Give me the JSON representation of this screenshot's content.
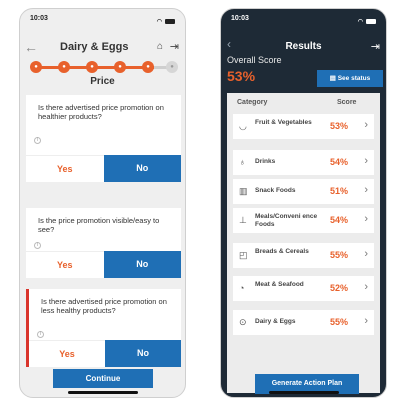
{
  "left": {
    "status_time": "10:03",
    "header": {
      "back_glyph": "←",
      "title": "Dairy & Eggs",
      "home_glyph": "⌂",
      "exit_glyph": "⇥"
    },
    "section_title": "Price",
    "questions": [
      {
        "text": "Is there advertised price promotion on healthier products?",
        "yes": "Yes",
        "no": "No",
        "selected": "No"
      },
      {
        "text": "Is the price promotion visible/easy to see?",
        "yes": "Yes",
        "no": "No",
        "selected": "No"
      },
      {
        "text": "Is there advertised price promotion on less healthy products?",
        "yes": "Yes",
        "no": "No",
        "selected": "No"
      }
    ],
    "info_glyph": "i",
    "continue_label": "Continue"
  },
  "right": {
    "status_time": "10:03",
    "title": "Results",
    "back_glyph": "‹",
    "exit_glyph": "⇥",
    "overall_label": "Overall Score",
    "overall_value": "53%",
    "see_status_label": "See status",
    "col_category": "Category",
    "col_score": "Score",
    "categories": [
      {
        "name": "Fruit & Vegetables",
        "score": "53%",
        "icon": "bowl-icon"
      },
      {
        "name": "Drinks",
        "score": "54%",
        "icon": "drink-icon"
      },
      {
        "name": "Snack Foods",
        "score": "51%",
        "icon": "snack-icon"
      },
      {
        "name": "Meals/Conveni ence Foods",
        "score": "54%",
        "icon": "meal-icon"
      },
      {
        "name": "Breads & Cereals",
        "score": "55%",
        "icon": "bread-icon"
      },
      {
        "name": "Meat & Seafood",
        "score": "52%",
        "icon": "meat-icon"
      },
      {
        "name": "Dairy & Eggs",
        "score": "55%",
        "icon": "dairy-icon"
      }
    ],
    "chevron_glyph": "›",
    "action_label": "Generate Action Plan"
  },
  "colors": {
    "accent_orange": "#e8612c",
    "primary_blue": "#1f6fb5",
    "dark_bg": "#1e2a36",
    "flag_red": "#d9342b"
  }
}
